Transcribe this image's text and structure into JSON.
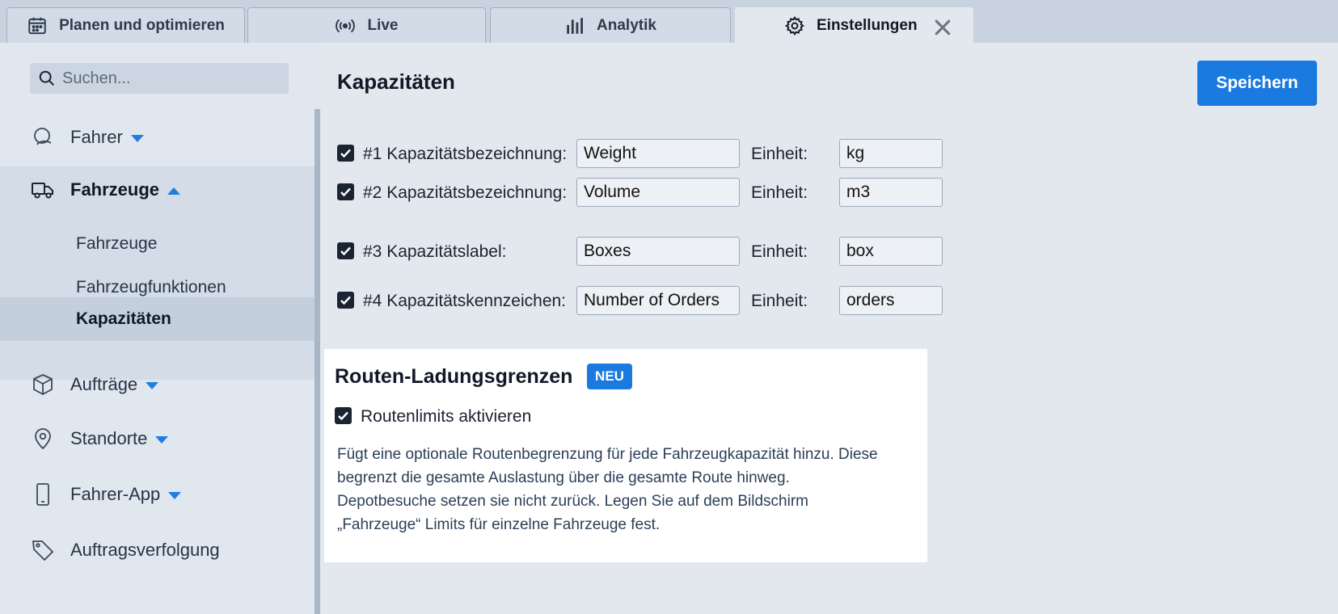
{
  "tabs": [
    {
      "label": "Planen und optimieren",
      "icon": "calendar-icon"
    },
    {
      "label": "Live",
      "icon": "broadcast-icon"
    },
    {
      "label": "Analytik",
      "icon": "bar-chart-icon"
    },
    {
      "label": "Einstellungen",
      "icon": "gear-icon",
      "active": true
    }
  ],
  "sidebar": {
    "search_placeholder": "Suchen...",
    "items": [
      {
        "label": "Fahrer",
        "icon": "user-icon"
      },
      {
        "label": "Fahrzeuge",
        "icon": "truck-icon",
        "open": true,
        "subitems": [
          "Fahrzeuge",
          "Fahrzeugfunktionen",
          "Kapazitäten"
        ]
      },
      {
        "label": "Aufträge",
        "icon": "package-icon"
      },
      {
        "label": "Standorte",
        "icon": "location-pin-icon"
      },
      {
        "label": "Fahrer-App",
        "icon": "phone-icon"
      },
      {
        "label": "Auftragsverfolgung",
        "icon": "tag-icon"
      }
    ]
  },
  "main": {
    "title": "Kapazitäten",
    "save_label": "Speichern",
    "unit_label": "Einheit:",
    "capacities": [
      {
        "label": "#1 Kapazitätsbezeichnung:",
        "name": "Weight",
        "unit": "kg",
        "checked": true
      },
      {
        "label": "#2 Kapazitätsbezeichnung:",
        "name": "Volume",
        "unit": "m3",
        "checked": true
      },
      {
        "label": "#3 Kapazitätslabel:",
        "name": "Boxes",
        "unit": "box",
        "checked": true
      },
      {
        "label": "#4 Kapazitätskennzeichen:",
        "name": "Number of Orders",
        "unit": "orders",
        "checked": true
      }
    ],
    "route_limits": {
      "title": "Routen-Ladungsgrenzen",
      "badge": "NEU",
      "checkbox_label": "Routenlimits aktivieren",
      "checked": true,
      "description_lines": [
        "Fügt eine optionale Routenbegrenzung für jede Fahrzeugkapazität hinzu. Diese",
        "begrenzt die gesamte Auslastung über die gesamte Route hinweg.",
        "Depotbesuche setzen sie nicht zurück. Legen Sie auf dem Bildschirm",
        "„Fahrzeuge“ Limits für einzelne Fahrzeuge fest."
      ]
    }
  },
  "colors": {
    "accent": "#1a7ae0",
    "sidebar_bg": "#e1e7ef",
    "panel_bg": "#ffffff"
  }
}
